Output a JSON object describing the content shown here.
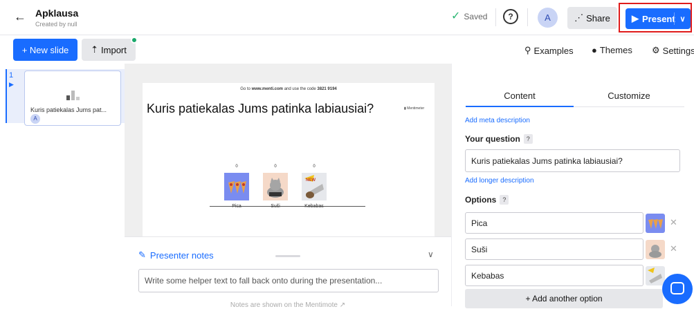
{
  "header": {
    "title": "Apklausa",
    "subtitle": "Created by null",
    "saved_label": "Saved",
    "help_label": "?",
    "avatar_initial": "A",
    "share_label": "Share",
    "present_label": "Present"
  },
  "toolbar": {
    "new_slide_label": "+ New slide",
    "import_label": "Import",
    "examples_label": "Examples",
    "themes_label": "Themes",
    "settings_label": "Settings"
  },
  "slides": [
    {
      "number": "1",
      "thumb_text": "Kuris patiekalas Jums pat...",
      "avatar_initial": "A"
    }
  ],
  "slide_preview": {
    "code_prefix": "Go to",
    "code_site": "www.menti.com",
    "code_middle": "and use the code",
    "code_value": "3821 9194",
    "brand": "Mentimeter",
    "question": "Kuris patiekalas Jums patinka labiausiai?"
  },
  "chart_data": {
    "type": "bar",
    "categories": [
      "Pica",
      "Suši",
      "Kebabas"
    ],
    "values": [
      0,
      0,
      0
    ]
  },
  "notes": {
    "heading": "Presenter notes",
    "placeholder": "Write some helper text to fall back onto during the presentation...",
    "footer": "Notes are shown on the Mentimote"
  },
  "editor": {
    "tabs": [
      "Content",
      "Customize"
    ],
    "active_tab": "Content",
    "meta_link": "Add meta description",
    "question_label": "Your question",
    "question_value": "Kuris patiekalas Jums patinka labiausiai?",
    "longer_link": "Add longer description",
    "options_label": "Options",
    "options": [
      {
        "value": "Pica",
        "image": "pizza-image"
      },
      {
        "value": "Suši",
        "image": "cat-sushi-image"
      },
      {
        "value": "Kebabas",
        "image": "kebab-image"
      }
    ],
    "add_option_label": "+ Add another option"
  },
  "colors": {
    "accent": "#196cff",
    "highlight": "#e01b1b",
    "pica_bar": "#7a8cf0",
    "susi_bar": "#f5d9c8",
    "kebabas_bar": "#e6e8ec"
  }
}
